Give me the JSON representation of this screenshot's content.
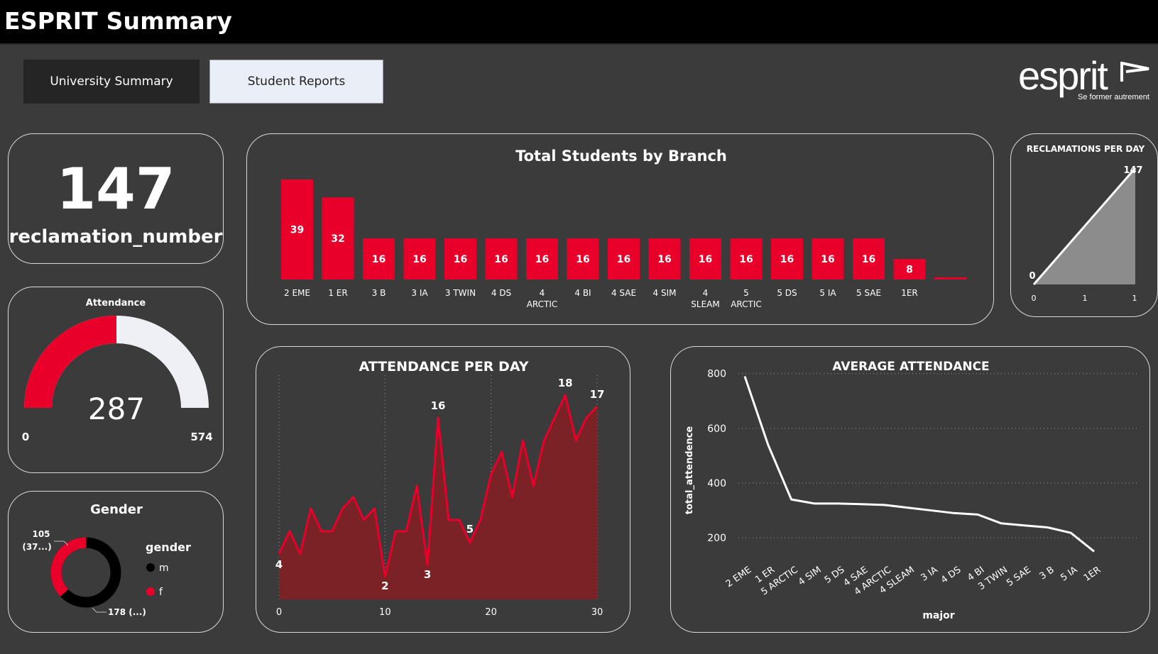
{
  "header": {
    "title": "ESPRIT Summary"
  },
  "nav": {
    "university_summary": "University Summary",
    "student_reports": "Student Reports"
  },
  "logo": {
    "word": "esprit",
    "tagline": "Se former autrement"
  },
  "kpi": {
    "value": "147",
    "label": "reclamation_number"
  },
  "attendance_gauge": {
    "title": "Attendance",
    "value": 287,
    "value_label": "287",
    "min_label": "0",
    "max_label": "574",
    "min": 0,
    "max": 574,
    "fill_color": "#e8002b",
    "track_color": "#eef0f6"
  },
  "gender": {
    "title": "Gender",
    "legend_title": "gender",
    "label_f": "105\n(37...)",
    "label_f_line1": "105",
    "label_f_line2": "(37...)",
    "label_m": "178 (...)",
    "legend": [
      {
        "name": "m",
        "color": "#000000"
      },
      {
        "name": "f",
        "color": "#e8002b"
      }
    ]
  },
  "colors": {
    "accent": "#e8002b",
    "area_fill": "#7a2226",
    "background": "#3b3b3b"
  },
  "chart_data": [
    {
      "id": "students_by_branch",
      "type": "bar",
      "title": "Total Students by Branch",
      "categories": [
        "2 EME",
        "1 ER",
        "3 B",
        "3 IA",
        "3 TWIN",
        "4 DS",
        "4 ARCTIC",
        "4 BI",
        "4 SAE",
        "4 SIM",
        "4 SLEAM",
        "5 ARCTIC",
        "5 DS",
        "5 IA",
        "5 SAE",
        "1ER",
        ""
      ],
      "category_lines": [
        [
          "2 EME"
        ],
        [
          "1 ER"
        ],
        [
          "3 B"
        ],
        [
          "3 IA"
        ],
        [
          "3 TWIN"
        ],
        [
          "4 DS"
        ],
        [
          "4",
          "ARCTIC"
        ],
        [
          "4 BI"
        ],
        [
          "4 SAE"
        ],
        [
          "4 SIM"
        ],
        [
          "4",
          "SLEAM"
        ],
        [
          "5",
          "ARCTIC"
        ],
        [
          "5 DS"
        ],
        [
          "5 IA"
        ],
        [
          "5 SAE"
        ],
        [
          "1ER"
        ],
        [
          ""
        ]
      ],
      "values": [
        39,
        32,
        16,
        16,
        16,
        16,
        16,
        16,
        16,
        16,
        16,
        16,
        16,
        16,
        16,
        8,
        1
      ],
      "value_labels": [
        "39",
        "32",
        "16",
        "16",
        "16",
        "16",
        "16",
        "16",
        "16",
        "16",
        "16",
        "16",
        "16",
        "16",
        "16",
        "8",
        ""
      ],
      "color": "#e8002b"
    },
    {
      "id": "reclamations_per_day",
      "type": "area",
      "title": "RECLAMATIONS PER DAY",
      "x": [
        0,
        1
      ],
      "values": [
        0,
        147
      ],
      "x_tick_labels": [
        "0",
        "1",
        "1"
      ],
      "point_labels": [
        "0",
        "147"
      ],
      "line_color": "#ffffff",
      "fill_color": "#8c8c8c"
    },
    {
      "id": "attendance_per_day",
      "type": "area",
      "title": "ATTENDANCE PER DAY",
      "x": [
        0,
        1,
        2,
        3,
        4,
        5,
        6,
        7,
        8,
        9,
        10,
        11,
        12,
        13,
        14,
        15,
        16,
        17,
        18,
        19,
        20,
        21,
        22,
        23,
        24,
        25,
        26,
        27,
        28,
        29,
        30
      ],
      "values": [
        4,
        6,
        4,
        8,
        6,
        6,
        8,
        9,
        7,
        8,
        2,
        6,
        6,
        10,
        3,
        16,
        7,
        7,
        5,
        7,
        11,
        13,
        9,
        14,
        10,
        14,
        16,
        18,
        14,
        16,
        17
      ],
      "xlim": [
        0,
        30
      ],
      "ylim": [
        0,
        19
      ],
      "x_tick_labels": [
        "0",
        "10",
        "20",
        "30"
      ],
      "annotations": [
        {
          "x": 0,
          "y": 4,
          "label": "4"
        },
        {
          "x": 10,
          "y": 2,
          "label": "2"
        },
        {
          "x": 14,
          "y": 3,
          "label": "3"
        },
        {
          "x": 15,
          "y": 16,
          "label": "16"
        },
        {
          "x": 18,
          "y": 5,
          "label": "5"
        },
        {
          "x": 27,
          "y": 18,
          "label": "18"
        },
        {
          "x": 30,
          "y": 17,
          "label": "17"
        }
      ],
      "line_color": "#e8002b",
      "fill_color": "#7a2226"
    },
    {
      "id": "average_attendance",
      "type": "line",
      "title": "AVERAGE ATTENDANCE",
      "xlabel": "major",
      "ylabel": "total_attendence",
      "categories": [
        "2 EME",
        "1 ER",
        "5 ARCTIC",
        "4 SIM",
        "5 DS",
        "4 SAE",
        "4 ARCTIC",
        "4 SLEAM",
        "3 IA",
        "4 DS",
        "4 BI",
        "3 TWIN",
        "5 SAE",
        "3 B",
        "5 IA",
        "1ER"
      ],
      "values": [
        790,
        540,
        340,
        325,
        325,
        323,
        320,
        310,
        300,
        290,
        285,
        253,
        245,
        238,
        218,
        150
      ],
      "ylim": [
        120,
        820
      ],
      "y_ticks": [
        200,
        400,
        600,
        800
      ],
      "y_tick_labels": [
        "200",
        "400",
        "600",
        "800"
      ],
      "line_color": "#ffffff"
    }
  ]
}
